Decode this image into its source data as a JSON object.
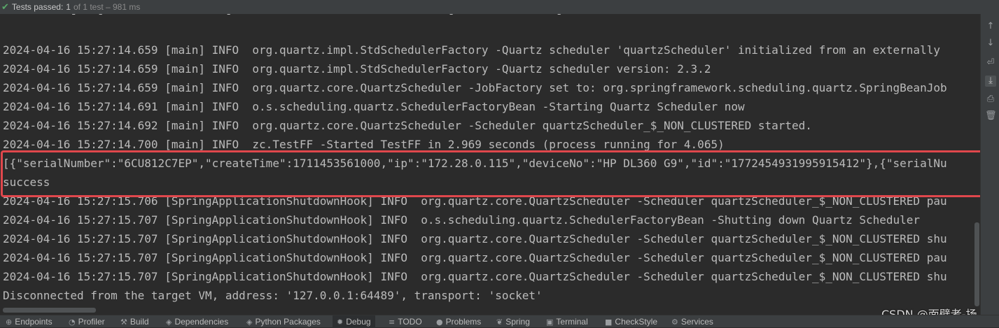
{
  "status": {
    "check_icon": "✔",
    "label": "Tests passed:",
    "count": "1",
    "detail": "of 1 test – 981 ms"
  },
  "console": {
    "partial_top": "          -   -                  -                                -               -  ",
    "lines": [
      "2024-04-16 15:27:14.659 [main] INFO  org.quartz.impl.StdSchedulerFactory -Quartz scheduler 'quartzScheduler' initialized from an externally",
      "2024-04-16 15:27:14.659 [main] INFO  org.quartz.impl.StdSchedulerFactory -Quartz scheduler version: 2.3.2",
      "2024-04-16 15:27:14.659 [main] INFO  org.quartz.core.QuartzScheduler -JobFactory set to: org.springframework.scheduling.quartz.SpringBeanJob",
      "2024-04-16 15:27:14.691 [main] INFO  o.s.scheduling.quartz.SchedulerFactoryBean -Starting Quartz Scheduler now",
      "2024-04-16 15:27:14.692 [main] INFO  org.quartz.core.QuartzScheduler -Scheduler quartzScheduler_$_NON_CLUSTERED started.",
      "2024-04-16 15:27:14.700 [main] INFO  zc.TestFF -Started TestFF in 2.969 seconds (process running for 4.065)",
      "[{\"serialNumber\":\"6CU812C7EP\",\"createTime\":1711453561000,\"ip\":\"172.28.0.115\",\"deviceNo\":\"HP DL360 G9\",\"id\":\"1772454931995915412\"},{\"serialNu",
      "success",
      "2024-04-16 15:27:15.706 [SpringApplicationShutdownHook] INFO  org.quartz.core.QuartzScheduler -Scheduler quartzScheduler_$_NON_CLUSTERED pau",
      "2024-04-16 15:27:15.707 [SpringApplicationShutdownHook] INFO  o.s.scheduling.quartz.SchedulerFactoryBean -Shutting down Quartz Scheduler",
      "2024-04-16 15:27:15.707 [SpringApplicationShutdownHook] INFO  org.quartz.core.QuartzScheduler -Scheduler quartzScheduler_$_NON_CLUSTERED shu",
      "2024-04-16 15:27:15.707 [SpringApplicationShutdownHook] INFO  org.quartz.core.QuartzScheduler -Scheduler quartzScheduler_$_NON_CLUSTERED pau",
      "2024-04-16 15:27:15.707 [SpringApplicationShutdownHook] INFO  org.quartz.core.QuartzScheduler -Scheduler quartzScheduler_$_NON_CLUSTERED shu",
      "Disconnected from the target VM, address: '127.0.0.1:64489', transport: 'socket'"
    ],
    "highlight_color": "#e0474c",
    "text_color": "#bbbbbb",
    "background": "#2b2b2b"
  },
  "right_toolbar": [
    {
      "icon": "arrow-up-icon",
      "glyph": "↑"
    },
    {
      "icon": "arrow-down-icon",
      "glyph": "↓"
    },
    {
      "icon": "soft-wrap-icon",
      "glyph": "⏎"
    },
    {
      "icon": "scroll-to-end-icon",
      "glyph": "⤓"
    },
    {
      "icon": "print-icon",
      "glyph": "⎙"
    },
    {
      "icon": "trash-icon",
      "glyph": "🗑"
    }
  ],
  "bottom_tabs": [
    {
      "icon": "endpoints-icon",
      "glyph": "⊕",
      "label": "Endpoints"
    },
    {
      "icon": "profiler-icon",
      "glyph": "◔",
      "label": "Profiler"
    },
    {
      "icon": "build-icon",
      "glyph": "⚒",
      "label": "Build"
    },
    {
      "icon": "dependencies-icon",
      "glyph": "◈",
      "label": "Dependencies"
    },
    {
      "icon": "python-packages-icon",
      "glyph": "◈",
      "label": "Python Packages"
    },
    {
      "icon": "debug-icon",
      "glyph": "✹",
      "label": "Debug"
    },
    {
      "icon": "todo-icon",
      "glyph": "≡",
      "label": "TODO"
    },
    {
      "icon": "problems-icon",
      "glyph": "●",
      "label": "Problems"
    },
    {
      "icon": "spring-icon",
      "glyph": "❦",
      "label": "Spring"
    },
    {
      "icon": "terminal-icon",
      "glyph": "▣",
      "label": "Terminal"
    },
    {
      "icon": "checkstyle-icon",
      "glyph": "■",
      "label": "CheckStyle"
    },
    {
      "icon": "services-icon",
      "glyph": "⚙",
      "label": "Services"
    }
  ],
  "watermark": "CSDN @面壁者-扬"
}
